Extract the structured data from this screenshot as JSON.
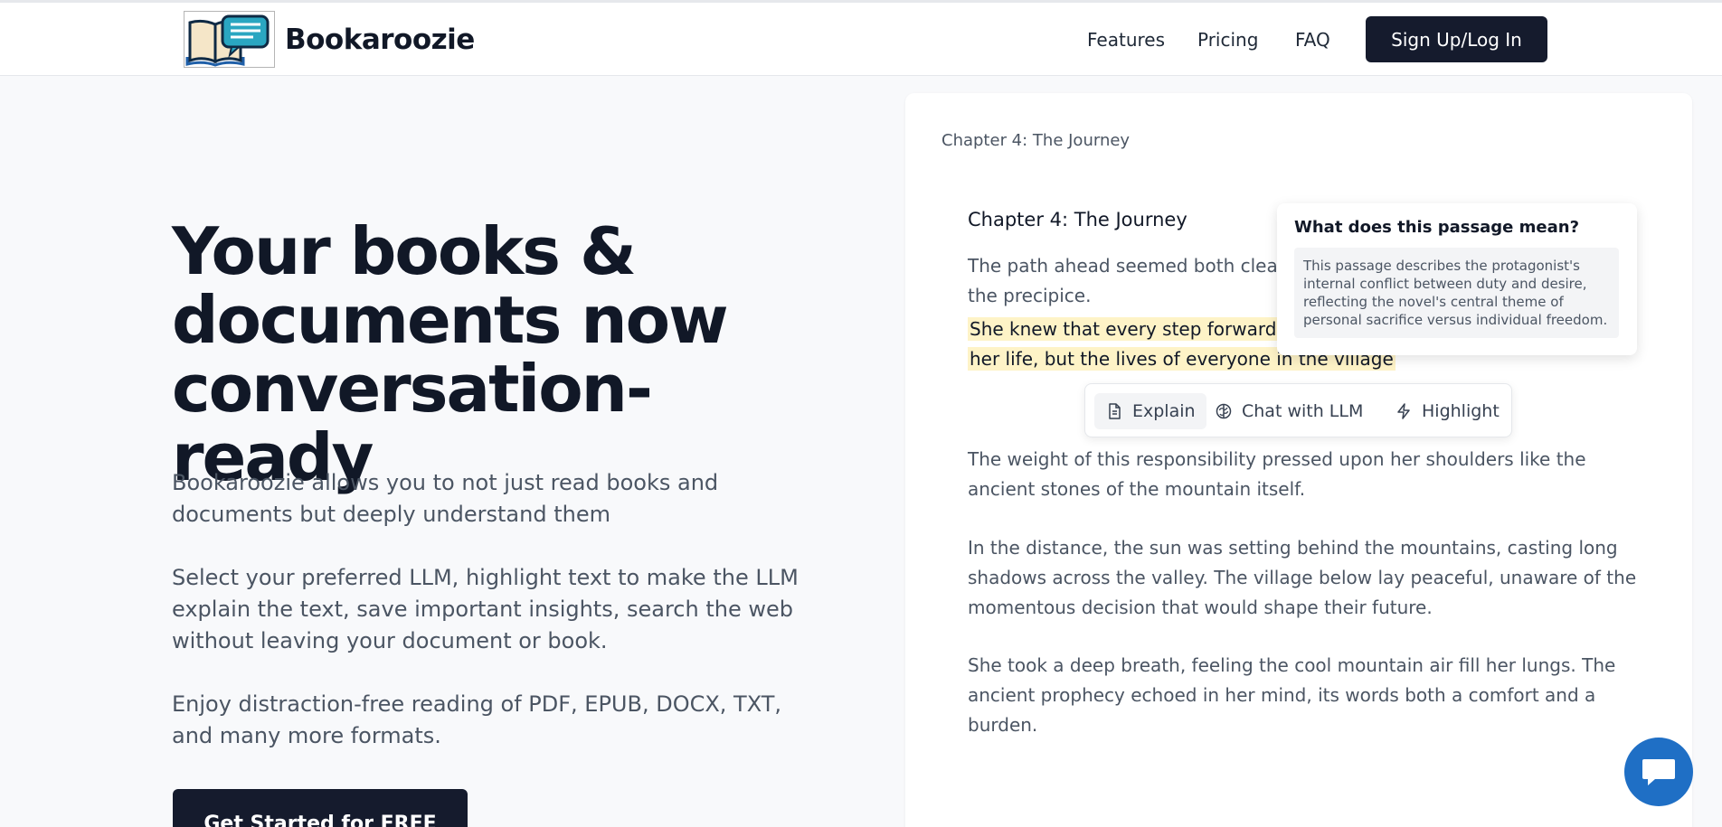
{
  "header": {
    "brand": "Bookaroozie",
    "nav": [
      "Features",
      "Pricing",
      "FAQ"
    ],
    "signup_label": "Sign Up/Log In"
  },
  "hero": {
    "title_lines": [
      "Your books &",
      "documents now",
      "conversation-ready"
    ],
    "paragraphs": [
      "Bookaroozie allows you to not just read books and documents but deeply understand them",
      "Select your preferred LLM, highlight text to make the LLM explain the text, save important insights, search the web without leaving your document or book.",
      "Enjoy distraction-free reading of PDF, EPUB, DOCX, TXT, and many more formats."
    ],
    "cta_label": "Get Started for FREE"
  },
  "reader": {
    "breadcrumb": "Chapter 4: The Journey",
    "chapter_title": "Chapter 4: The Journey",
    "intro_text": "The path ahead seemed both clear a",
    "intro_text_2": "the precipice.",
    "highlighted_line_1": "She knew that every step forward w",
    "highlighted_line_2": "her life, but the lives of everyone in the village",
    "paragraphs": [
      "The weight of this responsibility pressed upon her shoulders like the ancient stones of the mountain itself.",
      "In the distance, the sun was setting behind the mountains, casting long shadows across the valley. The village below lay peaceful, unaware of the momentous decision that would shape their future.",
      "She took a deep breath, feeling the cool mountain air fill her lungs. The ancient prophecy echoed in her mind, its words both a comfort and a burden."
    ]
  },
  "tooltip": {
    "question": "What does this passage mean?",
    "answer": "This passage describes the protagonist's internal conflict between duty and desire, reflecting the novel's central theme of personal sacrifice versus individual freedom."
  },
  "toolbar": {
    "explain_label": "Explain",
    "chat_label": "Chat with LLM",
    "highlight_label": "Highlight"
  },
  "icons": {
    "explain": "document-icon",
    "chat": "brain-icon",
    "highlight": "lightning-icon",
    "fab": "chat-bubble-icon"
  },
  "colors": {
    "primary_dark": "#151b2d",
    "highlight": "#fef3c7",
    "fab": "#1f6fc5"
  }
}
